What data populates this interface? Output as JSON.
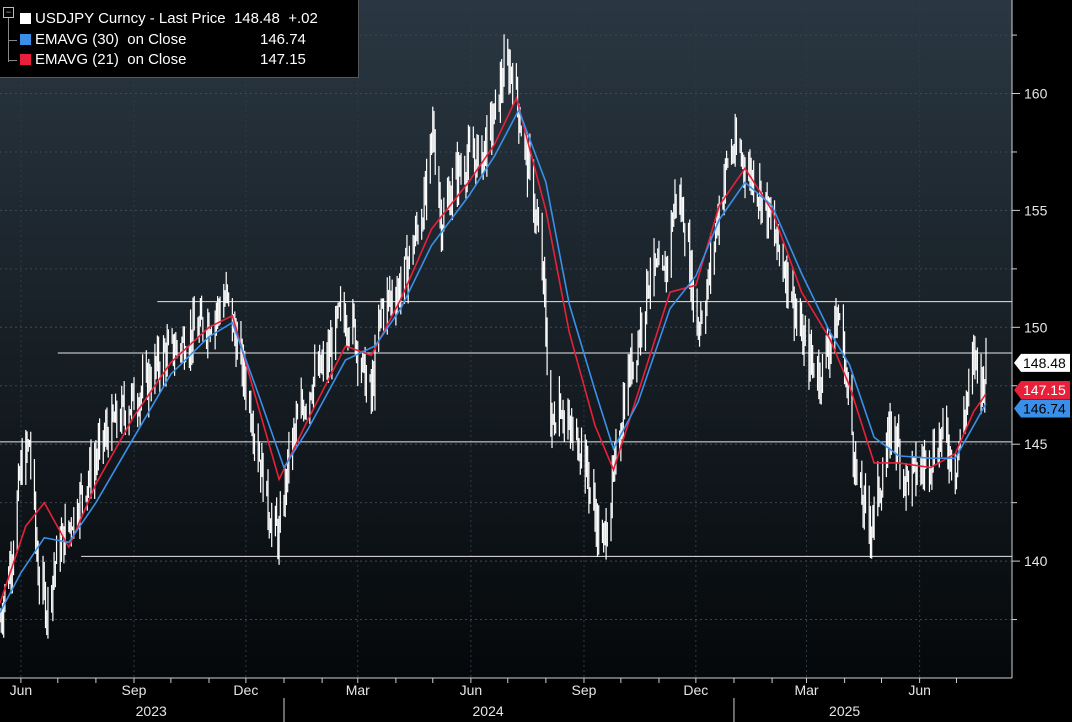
{
  "legend": {
    "price": {
      "name": "USDJPY Curncy - Last Price",
      "value": "148.48",
      "change": "+.02",
      "color": "#ffffff"
    },
    "ema30": {
      "name": "EMAVG (30)  on Close",
      "value": "146.74",
      "color": "#3a8fe8"
    },
    "ema21": {
      "name": "EMAVG (21)  on Close",
      "value": "147.15",
      "color": "#e8203a"
    }
  },
  "chart_data": {
    "type": "line",
    "x_range": [
      "2023-05-15",
      "2025-07-25"
    ],
    "ylim": [
      135,
      164
    ],
    "y_ticks": [
      140,
      145,
      150,
      155,
      160
    ],
    "x_month_ticks": [
      {
        "label": "Jun",
        "date": "2023-06-01"
      },
      {
        "label": "Sep",
        "date": "2023-09-01"
      },
      {
        "label": "Dec",
        "date": "2023-12-01"
      },
      {
        "label": "Mar",
        "date": "2024-03-01"
      },
      {
        "label": "Jun",
        "date": "2024-06-01"
      },
      {
        "label": "Sep",
        "date": "2024-09-01"
      },
      {
        "label": "Dec",
        "date": "2024-12-01"
      },
      {
        "label": "Mar",
        "date": "2025-03-01"
      },
      {
        "label": "Jun",
        "date": "2025-06-01"
      }
    ],
    "x_year_labels": [
      {
        "label": "2023",
        "date": "2023-09-15"
      },
      {
        "label": "2024",
        "date": "2024-06-15"
      },
      {
        "label": "2025",
        "date": "2025-04-01"
      }
    ],
    "year_dividers": [
      "2024-01-01",
      "2025-01-01"
    ],
    "horizontal_lines": [
      {
        "y": 151.1,
        "from": "2023-09-20"
      },
      {
        "y": 148.9,
        "from": "2023-07-01"
      },
      {
        "y": 145.1,
        "from": "2023-05-15"
      },
      {
        "y": 140.2,
        "from": "2023-07-20"
      }
    ],
    "grid": "horizontal dashed",
    "series": [
      {
        "name": "USDJPY Curncy - Last Price",
        "color": "#ffffff",
        "style": "high-low bars",
        "points": [
          [
            "2023-05-15",
            137.5
          ],
          [
            "2023-05-25",
            140.5
          ],
          [
            "2023-06-01",
            144.0
          ],
          [
            "2023-06-08",
            145.0
          ],
          [
            "2023-06-15",
            139.5
          ],
          [
            "2023-06-22",
            138.0
          ],
          [
            "2023-07-01",
            140.5
          ],
          [
            "2023-07-10",
            141.5
          ],
          [
            "2023-07-25",
            143.5
          ],
          [
            "2023-08-10",
            145.5
          ],
          [
            "2023-08-25",
            146.5
          ],
          [
            "2023-09-10",
            147.5
          ],
          [
            "2023-09-25",
            148.8
          ],
          [
            "2023-10-10",
            149.3
          ],
          [
            "2023-10-25",
            150.0
          ],
          [
            "2023-11-05",
            150.5
          ],
          [
            "2023-11-15",
            151.3
          ],
          [
            "2023-11-25",
            149.0
          ],
          [
            "2023-12-05",
            146.5
          ],
          [
            "2023-12-12",
            144.5
          ],
          [
            "2023-12-20",
            142.0
          ],
          [
            "2023-12-28",
            141.0
          ],
          [
            "2024-01-05",
            144.5
          ],
          [
            "2024-01-15",
            146.5
          ],
          [
            "2024-01-25",
            147.8
          ],
          [
            "2024-02-05",
            148.5
          ],
          [
            "2024-02-15",
            150.5
          ],
          [
            "2024-02-25",
            150.3
          ],
          [
            "2024-03-05",
            148.2
          ],
          [
            "2024-03-12",
            147.0
          ],
          [
            "2024-03-20",
            150.8
          ],
          [
            "2024-04-05",
            151.8
          ],
          [
            "2024-04-15",
            153.5
          ],
          [
            "2024-04-25",
            155.5
          ],
          [
            "2024-05-01",
            158.5
          ],
          [
            "2024-05-08",
            154.5
          ],
          [
            "2024-05-20",
            156.5
          ],
          [
            "2024-05-30",
            157.2
          ],
          [
            "2024-06-10",
            157.3
          ],
          [
            "2024-06-20",
            159.0
          ],
          [
            "2024-06-28",
            161.0
          ],
          [
            "2024-07-05",
            161.0
          ],
          [
            "2024-07-12",
            158.5
          ],
          [
            "2024-07-22",
            155.5
          ],
          [
            "2024-07-30",
            152.0
          ],
          [
            "2024-08-05",
            145.5
          ],
          [
            "2024-08-12",
            147.0
          ],
          [
            "2024-08-20",
            145.5
          ],
          [
            "2024-08-30",
            145.0
          ],
          [
            "2024-09-10",
            142.0
          ],
          [
            "2024-09-16",
            140.5
          ],
          [
            "2024-09-25",
            143.5
          ],
          [
            "2024-10-05",
            147.5
          ],
          [
            "2024-10-15",
            149.5
          ],
          [
            "2024-10-25",
            152.5
          ],
          [
            "2024-11-05",
            152.0
          ],
          [
            "2024-11-15",
            155.8
          ],
          [
            "2024-11-22",
            154.5
          ],
          [
            "2024-12-02",
            150.0
          ],
          [
            "2024-12-10",
            151.5
          ],
          [
            "2024-12-18",
            154.5
          ],
          [
            "2024-12-28",
            157.5
          ],
          [
            "2025-01-05",
            157.5
          ],
          [
            "2025-01-15",
            156.5
          ],
          [
            "2025-01-25",
            155.5
          ],
          [
            "2025-02-05",
            153.5
          ],
          [
            "2025-02-15",
            152.0
          ],
          [
            "2025-02-25",
            149.5
          ],
          [
            "2025-03-05",
            148.5
          ],
          [
            "2025-03-12",
            148.0
          ],
          [
            "2025-03-20",
            149.5
          ],
          [
            "2025-03-28",
            150.5
          ],
          [
            "2025-04-05",
            146.5
          ],
          [
            "2025-04-12",
            143.0
          ],
          [
            "2025-04-22",
            141.5
          ],
          [
            "2025-05-01",
            143.5
          ],
          [
            "2025-05-10",
            146.0
          ],
          [
            "2025-05-20",
            143.5
          ],
          [
            "2025-05-30",
            143.8
          ],
          [
            "2025-06-10",
            144.5
          ],
          [
            "2025-06-20",
            145.5
          ],
          [
            "2025-06-30",
            144.0
          ],
          [
            "2025-07-08",
            146.5
          ],
          [
            "2025-07-16",
            148.8
          ],
          [
            "2025-07-22",
            147.5
          ],
          [
            "2025-07-25",
            148.48
          ]
        ]
      },
      {
        "name": "EMAVG (30)  on Close",
        "color": "#3a8fe8",
        "style": "line",
        "points": [
          [
            "2023-05-15",
            137.8
          ],
          [
            "2023-06-01",
            139.5
          ],
          [
            "2023-06-20",
            141.0
          ],
          [
            "2023-07-10",
            140.8
          ],
          [
            "2023-08-01",
            142.5
          ],
          [
            "2023-09-01",
            145.3
          ],
          [
            "2023-10-01",
            148.0
          ],
          [
            "2023-11-01",
            149.6
          ],
          [
            "2023-11-20",
            150.2
          ],
          [
            "2023-12-10",
            147.3
          ],
          [
            "2024-01-01",
            144.0
          ],
          [
            "2024-01-20",
            145.6
          ],
          [
            "2024-02-20",
            148.6
          ],
          [
            "2024-03-15",
            149.2
          ],
          [
            "2024-04-05",
            150.8
          ],
          [
            "2024-04-30",
            153.5
          ],
          [
            "2024-05-30",
            155.6
          ],
          [
            "2024-06-20",
            157.3
          ],
          [
            "2024-07-10",
            159.3
          ],
          [
            "2024-08-01",
            156.2
          ],
          [
            "2024-08-20",
            151.0
          ],
          [
            "2024-09-10",
            147.3
          ],
          [
            "2024-09-25",
            144.8
          ],
          [
            "2024-10-15",
            146.8
          ],
          [
            "2024-11-10",
            150.8
          ],
          [
            "2024-12-01",
            152.2
          ],
          [
            "2024-12-20",
            154.6
          ],
          [
            "2025-01-10",
            156.2
          ],
          [
            "2025-02-01",
            155.2
          ],
          [
            "2025-02-25",
            152.3
          ],
          [
            "2025-03-20",
            149.8
          ],
          [
            "2025-04-05",
            148.4
          ],
          [
            "2025-04-25",
            145.3
          ],
          [
            "2025-05-15",
            144.5
          ],
          [
            "2025-06-10",
            144.4
          ],
          [
            "2025-06-30",
            144.4
          ],
          [
            "2025-07-15",
            145.8
          ],
          [
            "2025-07-25",
            146.74
          ]
        ]
      },
      {
        "name": "EMAVG (21)  on Close",
        "color": "#e8203a",
        "style": "line",
        "points": [
          [
            "2023-05-15",
            138.2
          ],
          [
            "2023-06-05",
            141.5
          ],
          [
            "2023-06-20",
            142.5
          ],
          [
            "2023-07-10",
            140.6
          ],
          [
            "2023-08-01",
            143.3
          ],
          [
            "2023-09-01",
            146.2
          ],
          [
            "2023-10-01",
            148.5
          ],
          [
            "2023-11-01",
            150.0
          ],
          [
            "2023-11-20",
            150.5
          ],
          [
            "2023-12-10",
            146.8
          ],
          [
            "2023-12-28",
            143.5
          ],
          [
            "2024-01-20",
            146.0
          ],
          [
            "2024-02-20",
            149.2
          ],
          [
            "2024-03-12",
            148.8
          ],
          [
            "2024-04-05",
            151.2
          ],
          [
            "2024-04-30",
            154.2
          ],
          [
            "2024-05-30",
            156.2
          ],
          [
            "2024-06-20",
            157.8
          ],
          [
            "2024-07-08",
            159.8
          ],
          [
            "2024-08-01",
            155.0
          ],
          [
            "2024-08-20",
            149.8
          ],
          [
            "2024-09-10",
            145.8
          ],
          [
            "2024-09-25",
            143.9
          ],
          [
            "2024-10-15",
            147.2
          ],
          [
            "2024-11-10",
            151.5
          ],
          [
            "2024-12-01",
            151.8
          ],
          [
            "2024-12-20",
            155.2
          ],
          [
            "2025-01-10",
            156.8
          ],
          [
            "2025-02-01",
            155.0
          ],
          [
            "2025-02-25",
            151.5
          ],
          [
            "2025-03-20",
            149.5
          ],
          [
            "2025-04-05",
            147.5
          ],
          [
            "2025-04-25",
            144.2
          ],
          [
            "2025-05-15",
            144.2
          ],
          [
            "2025-06-10",
            144.0
          ],
          [
            "2025-06-30",
            144.6
          ],
          [
            "2025-07-15",
            146.4
          ],
          [
            "2025-07-25",
            147.15
          ]
        ]
      }
    ]
  }
}
